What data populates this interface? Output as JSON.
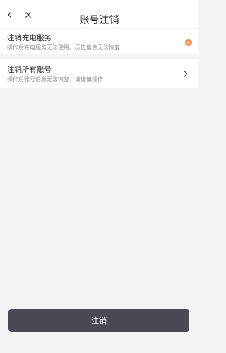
{
  "header": {
    "title": "账号注销",
    "back_icon": "back-arrow-icon",
    "close_icon": "close-icon"
  },
  "options": [
    {
      "title": "注销充电服务",
      "description": "操作后充电服务无法使用，历史信息无法恢复",
      "state": "selected",
      "icon": "check-circle-icon",
      "accent": "#f5894a"
    },
    {
      "title": "注销所有账号",
      "description": "操作后账号信息无法恢复，请谨慎操作",
      "icon": "chevron-right-icon"
    }
  ],
  "footer": {
    "button_label": "注销",
    "button_color": "#4a4a55"
  }
}
